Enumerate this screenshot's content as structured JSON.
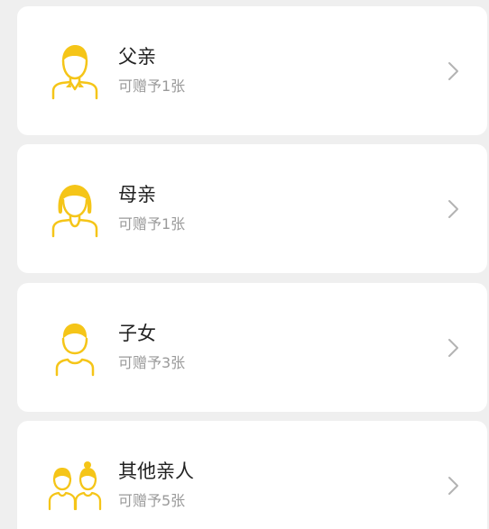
{
  "accent_color": "#f5c518",
  "items": [
    {
      "title": "父亲",
      "subtitle": "可赠予1张",
      "icon": "father-icon",
      "chevron": "chevron-right-icon"
    },
    {
      "title": "母亲",
      "subtitle": "可赠予1张",
      "icon": "mother-icon",
      "chevron": "chevron-right-icon"
    },
    {
      "title": "子女",
      "subtitle": "可赠予3张",
      "icon": "child-icon",
      "chevron": "chevron-right-icon"
    },
    {
      "title": "其他亲人",
      "subtitle": "可赠予5张",
      "icon": "other-relatives-icon",
      "chevron": "chevron-right-icon"
    }
  ]
}
